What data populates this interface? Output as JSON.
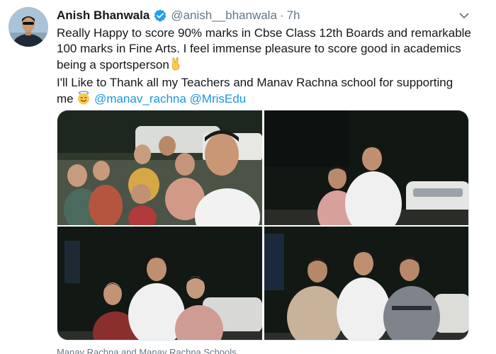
{
  "tweet": {
    "author_name": "Anish Bhanwala",
    "author_handle": "@anish__bhanwala",
    "separator": "·",
    "timestamp": "7h",
    "text_lines": [
      "Really Happy to score 90% marks in Cbse Class 12th Boards and remarkable",
      "100 marks in Fine Arts. I feel immense pleasure to score good in academics",
      "being a sportsperson",
      "I'll Like to Thank all my Teachers and Manav Rachna school for supporting",
      "me"
    ],
    "mentions": [
      "@manav_rachna",
      "@MrisEdu"
    ],
    "emojis": [
      "victory-hand-emoji",
      "smiling-face-with-halo-emoji"
    ],
    "media_caption": "Manav Rachna and Manav Rachna Schools"
  },
  "colors": {
    "text": "#14171a",
    "secondary": "#657786",
    "link": "#1b95e0",
    "verified": "#1da1f2"
  },
  "icons": [
    "verified-badge-icon",
    "chevron-down-icon"
  ]
}
